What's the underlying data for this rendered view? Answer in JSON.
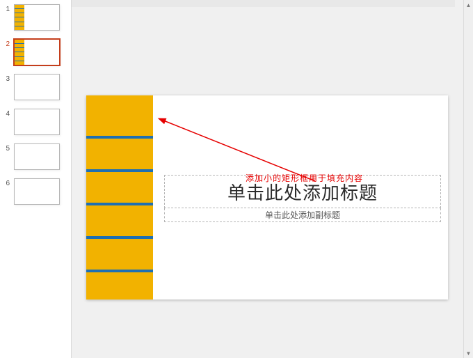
{
  "thumbnails": {
    "count": 6,
    "selected_index": 2,
    "items": [
      {
        "number": "1",
        "has_strip": true
      },
      {
        "number": "2",
        "has_strip": true
      },
      {
        "number": "3",
        "has_strip": false
      },
      {
        "number": "4",
        "has_strip": false
      },
      {
        "number": "5",
        "has_strip": false
      },
      {
        "number": "6",
        "has_strip": false
      }
    ]
  },
  "slide": {
    "title_placeholder": "单击此处添加标题",
    "subtitle_placeholder": "单击此处添加副标题",
    "accent_color": "#f2b200",
    "bar_color": "#1f6fb2"
  },
  "annotation": {
    "text": "添加小的矩形框用于填充内容",
    "color": "#e60000"
  }
}
